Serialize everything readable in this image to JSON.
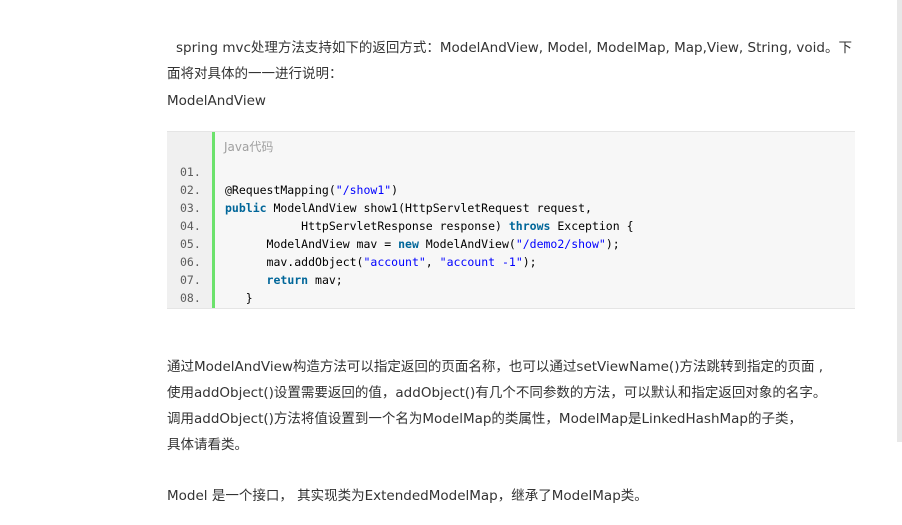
{
  "intro": "spring mvc处理方法支持如下的返回方式：ModelAndView, Model, ModelMap, Map,View, String, void。下面将对具体的一一进行说明：",
  "section_heading": "ModelAndView",
  "code_block": {
    "language_label": "Java代码",
    "lines": [
      {
        "num": "01.",
        "tokens": []
      },
      {
        "num": "02.",
        "tokens": [
          {
            "t": "@RequestMapping(",
            "c": ""
          },
          {
            "t": "\"/show1\"",
            "c": "str"
          },
          {
            "t": ")",
            "c": ""
          }
        ]
      },
      {
        "num": "03.",
        "tokens": [
          {
            "t": "public",
            "c": "kw"
          },
          {
            "t": " ModelAndView show1(HttpServletRequest request,",
            "c": ""
          }
        ]
      },
      {
        "num": "04.",
        "tokens": [
          {
            "t": "           HttpServletResponse response) ",
            "c": ""
          },
          {
            "t": "throws",
            "c": "kw"
          },
          {
            "t": " Exception {",
            "c": ""
          }
        ]
      },
      {
        "num": "05.",
        "tokens": [
          {
            "t": "      ModelAndView mav = ",
            "c": ""
          },
          {
            "t": "new",
            "c": "kw"
          },
          {
            "t": " ModelAndView(",
            "c": ""
          },
          {
            "t": "\"/demo2/show\"",
            "c": "str"
          },
          {
            "t": ");",
            "c": ""
          }
        ]
      },
      {
        "num": "06.",
        "tokens": [
          {
            "t": "      mav.addObject(",
            "c": ""
          },
          {
            "t": "\"account\"",
            "c": "str"
          },
          {
            "t": ", ",
            "c": ""
          },
          {
            "t": "\"account -1\"",
            "c": "str"
          },
          {
            "t": ");",
            "c": ""
          }
        ]
      },
      {
        "num": "07.",
        "tokens": [
          {
            "t": "      ",
            "c": ""
          },
          {
            "t": "return",
            "c": "kw"
          },
          {
            "t": " mav;",
            "c": ""
          }
        ]
      },
      {
        "num": "08.",
        "tokens": [
          {
            "t": "   }",
            "c": ""
          }
        ]
      }
    ]
  },
  "description_lines": [
    "通过ModelAndView构造方法可以指定返回的页面名称，也可以通过setViewName()方法跳转到指定的页面 ,",
    "使用addObject()设置需要返回的值，addObject()有几个不同参数的方法，可以默认和指定返回对象的名字。",
    "调用addObject()方法将值设置到一个名为ModelMap的类属性，ModelMap是LinkedHashMap的子类，",
    "具体请看类。"
  ],
  "model_paragraph": "Model 是一个接口， 其实现类为ExtendedModelMap，继承了ModelMap类。",
  "colors": {
    "keyword": "#006699",
    "string": "#0000ff",
    "gutter_border": "#6ce26c"
  }
}
